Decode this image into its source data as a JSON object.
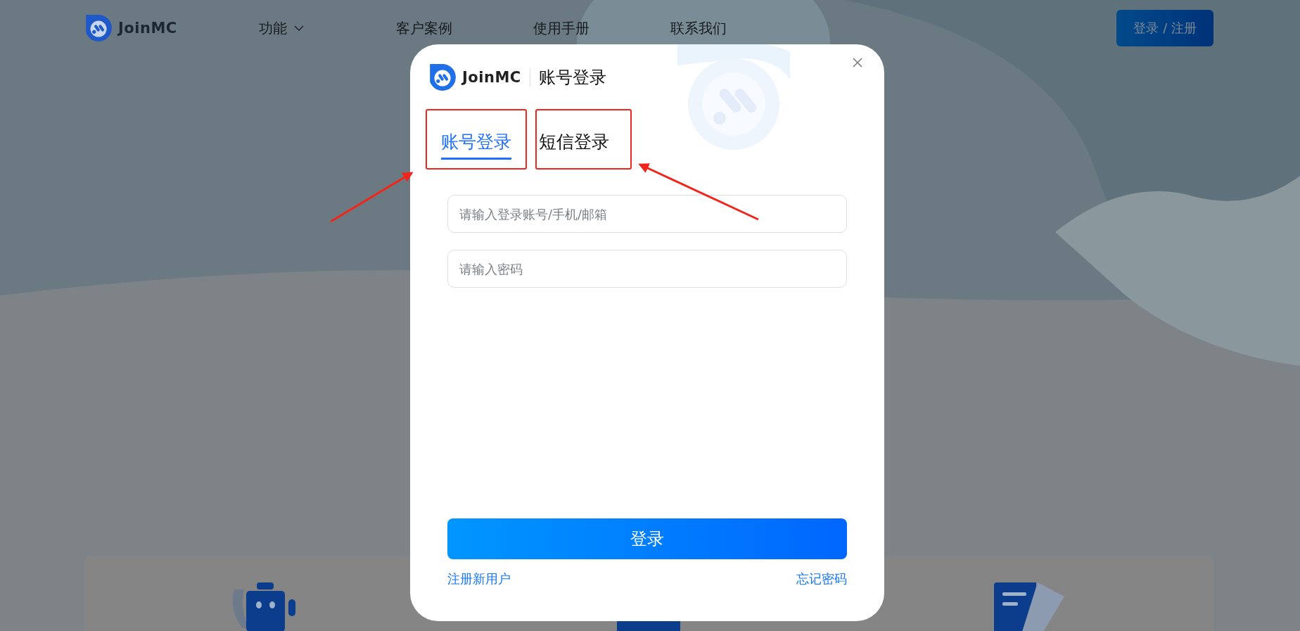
{
  "header": {
    "logo": "JoinMC",
    "nav": [
      {
        "label": "功能",
        "dropdown": true
      },
      {
        "label": "客户案例",
        "dropdown": false
      },
      {
        "label": "使用手册",
        "dropdown": false
      },
      {
        "label": "联系我们",
        "dropdown": false
      }
    ],
    "login_button": "登录 / 注册"
  },
  "modal": {
    "logo": "JoinMC",
    "title": "账号登录",
    "tabs": [
      {
        "label": "账号登录",
        "selected": true,
        "annotated": true
      },
      {
        "label": "短信登录",
        "selected": false,
        "annotated": true
      }
    ],
    "fields": [
      {
        "placeholder": "请输入登录账号/手机/邮箱"
      },
      {
        "placeholder": "请输入密码"
      }
    ],
    "submit": "登录",
    "links": [
      "注册新用户",
      "忘记密码"
    ]
  }
}
